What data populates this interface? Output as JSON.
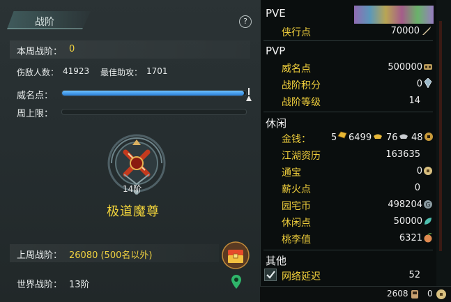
{
  "rank_panel": {
    "title": "战阶",
    "help": "?",
    "weekly_rank_label": "本周战阶：",
    "weekly_rank_value": "0",
    "enemies_label": "伤敌人数：",
    "enemies_value": "41923",
    "best_assist_label": "最佳助攻：",
    "best_assist_value": "1701",
    "prestige_label": "威名点：",
    "prestige_progress": 0.99,
    "weekly_cap_label": "周上限：",
    "weekly_cap_progress": 0.0,
    "rank_level": "14阶",
    "rank_name": "极道魔尊",
    "last_week_label": "上周战阶：",
    "last_week_value": "26080 (500名以外)",
    "world_rank_label": "世界战阶：",
    "world_rank_value": "13阶"
  },
  "currency_panel": {
    "pve": {
      "heading": "PVE",
      "items": [
        {
          "name": "侠行点",
          "value": "70000",
          "icon": "sword-icon"
        }
      ]
    },
    "pvp": {
      "heading": "PVP",
      "items": [
        {
          "name": "威名点",
          "value": "500000",
          "icon": "mask-icon"
        },
        {
          "name": "战阶积分",
          "value": "0",
          "icon": "crystal-icon"
        },
        {
          "name": "战阶等级",
          "value": "14",
          "icon": ""
        }
      ]
    },
    "leisure": {
      "heading": "休闲",
      "money_label": "金钱：",
      "money_gold_bricks": "5",
      "money_gold": "6499",
      "money_silver": "76",
      "money_copper": "48",
      "items": [
        {
          "name": "江湖资历",
          "value": "163635",
          "icon": ""
        },
        {
          "name": "通宝",
          "value": "0",
          "icon": "coin-icon"
        },
        {
          "name": "薪火点",
          "value": "0",
          "icon": ""
        },
        {
          "name": "园宅币",
          "value": "498204",
          "icon": "g-coin-icon"
        },
        {
          "name": "休闲点",
          "value": "50000",
          "icon": "leaf-icon"
        },
        {
          "name": "桃李值",
          "value": "6321",
          "icon": "peach-icon"
        }
      ]
    },
    "other": {
      "heading": "其他",
      "latency_label": "网络延迟",
      "latency_value": "52",
      "latency_checked": true
    }
  },
  "status_bar": {
    "value_a": "2608",
    "value_b": "0"
  },
  "colors": {
    "accent_yellow": "#f0cf3c",
    "bar_blue": "#2a7fd8",
    "panel_bg": "#262e30"
  }
}
